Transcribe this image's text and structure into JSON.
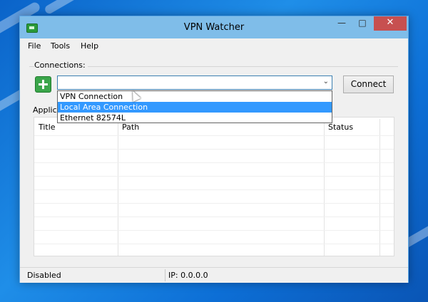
{
  "window": {
    "title": "VPN Watcher"
  },
  "menu": {
    "file": "File",
    "tools": "Tools",
    "help": "Help"
  },
  "connections": {
    "label": "Connections:",
    "selected_value": "",
    "options": [
      "VPN Connection",
      "Local Area Connection",
      "Ethernet 82574L"
    ],
    "highlighted_option": "Local Area Connection",
    "connect_label": "Connect"
  },
  "applications": {
    "label": "Applic",
    "columns": [
      "Title",
      "Path",
      "Status"
    ],
    "rows": []
  },
  "statusbar": {
    "state": "Disabled",
    "ip": "IP: 0.0.0.0"
  },
  "colors": {
    "accent": "#3399ff",
    "close": "#c75050",
    "add": "#3aa54a",
    "titlebar": "#7fbde9"
  }
}
